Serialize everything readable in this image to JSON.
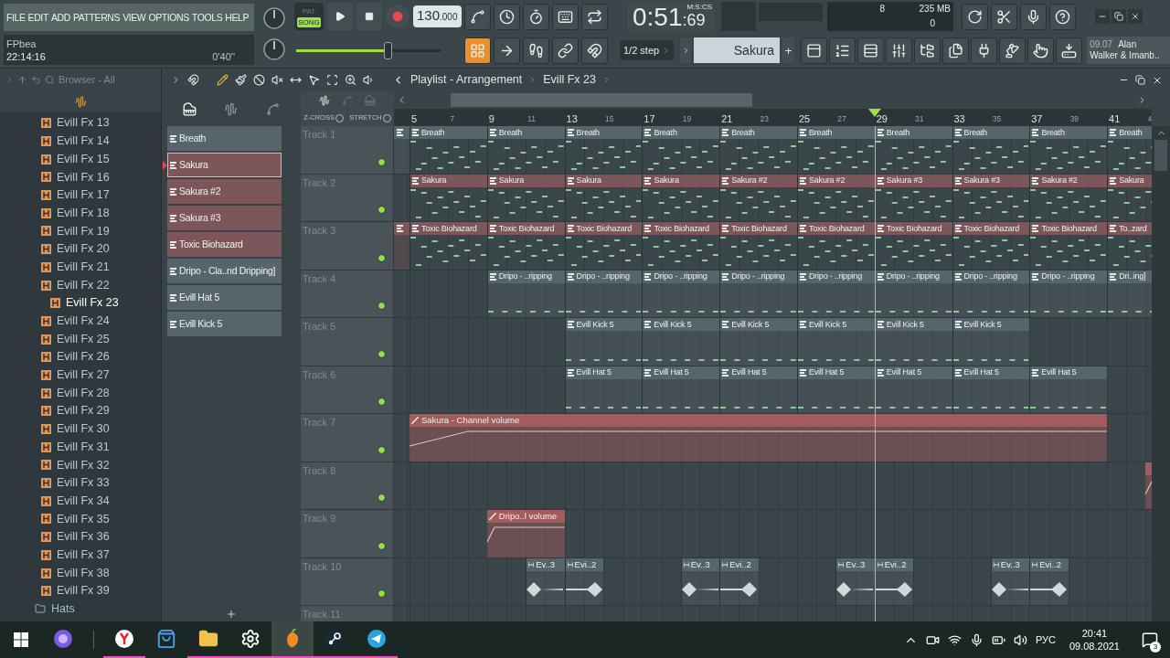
{
  "menu": [
    "FILE",
    "EDIT",
    "ADD",
    "PATTERNS",
    "VIEW",
    "OPTIONS",
    "TOOLS",
    "HELP"
  ],
  "hint": {
    "title": "FPbea",
    "time": "22:14:16",
    "length": "0'40''"
  },
  "transport": {
    "modes": [
      {
        "label": "PAT",
        "selected": false
      },
      {
        "label": "SONG",
        "selected": true
      }
    ],
    "tempo": "130",
    "tempo_decimals": ".000"
  },
  "master_volume": {
    "level": 0.63
  },
  "time": {
    "value": "0:51",
    "centiseconds": ":69",
    "format": "M:S:CS"
  },
  "cpu": {
    "voices": "8",
    "memory": "235 MB",
    "polyphony": "0"
  },
  "snap": "1/2 step",
  "pattern_selector": {
    "name": "Sakura",
    "add": "+"
  },
  "news": {
    "date": "09.07",
    "lines": [
      "Alan",
      "Walker & Imanb.."
    ]
  },
  "browser": {
    "title": "Browser - All",
    "items": [
      {
        "label": "Evill Fx 13",
        "kind": "file",
        "selected": false
      },
      {
        "label": "Evill Fx 14",
        "kind": "file",
        "selected": false
      },
      {
        "label": "Evill Fx 15",
        "kind": "file",
        "selected": false
      },
      {
        "label": "Evill Fx 16",
        "kind": "file",
        "selected": false
      },
      {
        "label": "Evill Fx 17",
        "kind": "file",
        "selected": false
      },
      {
        "label": "Evill Fx 18",
        "kind": "file",
        "selected": false
      },
      {
        "label": "Evill Fx 19",
        "kind": "file",
        "selected": false
      },
      {
        "label": "Evill Fx 20",
        "kind": "file",
        "selected": false
      },
      {
        "label": "Evill Fx 21",
        "kind": "file",
        "selected": false
      },
      {
        "label": "Evill Fx 22",
        "kind": "file",
        "selected": false
      },
      {
        "label": "Evill Fx 23",
        "kind": "file",
        "selected": true
      },
      {
        "label": "Evill Fx 24",
        "kind": "file",
        "selected": false
      },
      {
        "label": "Evill Fx 25",
        "kind": "file",
        "selected": false
      },
      {
        "label": "Evill Fx 26",
        "kind": "file",
        "selected": false
      },
      {
        "label": "Evill Fx 27",
        "kind": "file",
        "selected": false
      },
      {
        "label": "Evill Fx 28",
        "kind": "file",
        "selected": false
      },
      {
        "label": "Evill Fx 29",
        "kind": "file",
        "selected": false
      },
      {
        "label": "Evill Fx 30",
        "kind": "file",
        "selected": false
      },
      {
        "label": "Evill Fx 31",
        "kind": "file",
        "selected": false
      },
      {
        "label": "Evill Fx 32",
        "kind": "file",
        "selected": false
      },
      {
        "label": "Evill Fx 33",
        "kind": "file",
        "selected": false
      },
      {
        "label": "Evill Fx 34",
        "kind": "file",
        "selected": false
      },
      {
        "label": "Evill Fx 35",
        "kind": "file",
        "selected": false
      },
      {
        "label": "Evill Fx 36",
        "kind": "file",
        "selected": false
      },
      {
        "label": "Evill Fx 37",
        "kind": "file",
        "selected": false
      },
      {
        "label": "Evill Fx 38",
        "kind": "file",
        "selected": false
      },
      {
        "label": "Evill Fx 39",
        "kind": "file",
        "selected": false
      },
      {
        "label": "Hats",
        "kind": "folder",
        "selected": false
      }
    ]
  },
  "patterns": [
    {
      "name": "Breath",
      "color": "#56656b",
      "selected": false
    },
    {
      "name": "Sakura",
      "color": "#7c5659",
      "selected": true
    },
    {
      "name": "Sakura #2",
      "color": "#7c5659",
      "selected": false
    },
    {
      "name": "Sakura #3",
      "color": "#7c5659",
      "selected": false
    },
    {
      "name": "Toxic Biohazard",
      "color": "#7c5659",
      "selected": false
    },
    {
      "name": "Dripo - Cla..nd Dripping]",
      "color": "#56656b",
      "selected": false
    },
    {
      "name": "Evill Hat 5",
      "color": "#56656b",
      "selected": false
    },
    {
      "name": "Evill Kick 5",
      "color": "#56656b",
      "selected": false
    }
  ],
  "playlist": {
    "title": "Playlist - Arrangement",
    "current": "Evill Fx 23",
    "options": [
      "Z-CROSS",
      "STRETCH"
    ],
    "ruler": [
      {
        "label": "5",
        "major": true,
        "playhead": false
      },
      {
        "label": "7",
        "major": false,
        "playhead": false
      },
      {
        "label": "9",
        "major": true,
        "playhead": false
      },
      {
        "label": "11",
        "major": false,
        "playhead": false
      },
      {
        "label": "13",
        "major": true,
        "playhead": false
      },
      {
        "label": "15",
        "major": false,
        "playhead": false
      },
      {
        "label": "17",
        "major": true,
        "playhead": false
      },
      {
        "label": "19",
        "major": false,
        "playhead": false
      },
      {
        "label": "21",
        "major": true,
        "playhead": false
      },
      {
        "label": "23",
        "major": false,
        "playhead": false
      },
      {
        "label": "25",
        "major": true,
        "playhead": false
      },
      {
        "label": "27",
        "major": false,
        "playhead": false
      },
      {
        "label": "29",
        "major": true,
        "playhead": true
      },
      {
        "label": "31",
        "major": false,
        "playhead": false
      },
      {
        "label": "33",
        "major": true,
        "playhead": false
      },
      {
        "label": "35",
        "major": false,
        "playhead": false
      },
      {
        "label": "37",
        "major": true,
        "playhead": false
      },
      {
        "label": "39",
        "major": false,
        "playhead": false
      },
      {
        "label": "41",
        "major": true,
        "playhead": false
      },
      {
        "label": "4",
        "major": false,
        "playhead": false
      }
    ],
    "tracks": [
      {
        "name": "Track 1",
        "color": "#56656b",
        "enabled": true,
        "clips": [
          {
            "kind": "partial"
          },
          {
            "kind": "pattern",
            "label": "Breath"
          },
          {
            "kind": "pattern",
            "label": "Breath"
          },
          {
            "kind": "pattern",
            "label": "Breath"
          },
          {
            "kind": "pattern",
            "label": "Breath"
          },
          {
            "kind": "pattern",
            "label": "Breath"
          },
          {
            "kind": "pattern",
            "label": "Breath"
          },
          {
            "kind": "pattern",
            "label": "Breath"
          },
          {
            "kind": "pattern",
            "label": "Breath"
          },
          {
            "kind": "pattern",
            "label": "Breath"
          },
          {
            "kind": "pattern",
            "label": "Breath"
          }
        ]
      },
      {
        "name": "Track 2",
        "color": "#7c5659",
        "enabled": true,
        "clips": [
          {
            "kind": "pattern",
            "label": "Sakura"
          },
          {
            "kind": "pattern",
            "label": "Sakura"
          },
          {
            "kind": "pattern",
            "label": "Sakura"
          },
          {
            "kind": "pattern",
            "label": "Sakura"
          },
          {
            "kind": "pattern",
            "label": "Sakura #2"
          },
          {
            "kind": "pattern",
            "label": "Sakura #2"
          },
          {
            "kind": "pattern",
            "label": "Sakura #3"
          },
          {
            "kind": "pattern",
            "label": "Sakura #3"
          },
          {
            "kind": "pattern",
            "label": "Sakura #2"
          },
          {
            "kind": "pattern",
            "label": "Sakura"
          }
        ]
      },
      {
        "name": "Track 3",
        "color": "#7c5659",
        "enabled": true,
        "clips": [
          {
            "kind": "partial"
          },
          {
            "kind": "pattern",
            "label": "Toxic Biohazard"
          },
          {
            "kind": "pattern",
            "label": "Toxic Biohazard"
          },
          {
            "kind": "pattern",
            "label": "Toxic Biohazard"
          },
          {
            "kind": "pattern",
            "label": "Toxic Biohazard"
          },
          {
            "kind": "pattern",
            "label": "Toxic Biohazard"
          },
          {
            "kind": "pattern",
            "label": "Toxic Biohazard"
          },
          {
            "kind": "pattern",
            "label": "Toxic Biohazard"
          },
          {
            "kind": "pattern",
            "label": "Toxic Biohazard"
          },
          {
            "kind": "pattern",
            "label": "Toxic Biohazard"
          },
          {
            "kind": "pattern",
            "label": "To..zard"
          }
        ]
      },
      {
        "name": "Track 4",
        "color": "#56656b",
        "enabled": true,
        "clips": [
          {
            "kind": "gap"
          },
          {
            "kind": "gap"
          },
          {
            "kind": "pattern",
            "label": "Dripo - ..ripping"
          },
          {
            "kind": "pattern",
            "label": "Dripo - ..ripping"
          },
          {
            "kind": "pattern",
            "label": "Dripo - ..ripping"
          },
          {
            "kind": "pattern",
            "label": "Dripo - ..ripping"
          },
          {
            "kind": "pattern",
            "label": "Dripo - ..ripping"
          },
          {
            "kind": "pattern",
            "label": "Dripo - ..ripping"
          },
          {
            "kind": "pattern",
            "label": "Dripo - ..ripping"
          },
          {
            "kind": "pattern",
            "label": "Dripo - ..ripping"
          },
          {
            "kind": "pattern",
            "label": "Dri..ing]"
          }
        ]
      },
      {
        "name": "Track 5",
        "color": "#56656b",
        "enabled": true,
        "clips": [
          {
            "kind": "gap"
          },
          {
            "kind": "gap"
          },
          {
            "kind": "gap"
          },
          {
            "kind": "gap"
          },
          {
            "kind": "pattern",
            "label": "Evill Kick 5"
          },
          {
            "kind": "pattern",
            "label": "Evill Kick 5"
          },
          {
            "kind": "pattern",
            "label": "Evill Kick 5"
          },
          {
            "kind": "pattern",
            "label": "Evill Kick 5"
          },
          {
            "kind": "pattern",
            "label": "Evill Kick 5"
          },
          {
            "kind": "pattern",
            "label": "Evill Kick 5"
          }
        ]
      },
      {
        "name": "Track 6",
        "color": "#56656b",
        "enabled": true,
        "clips": [
          {
            "kind": "gap"
          },
          {
            "kind": "gap"
          },
          {
            "kind": "gap"
          },
          {
            "kind": "gap"
          },
          {
            "kind": "pattern",
            "label": "Evill Hat 5"
          },
          {
            "kind": "pattern",
            "label": "Evill Hat 5"
          },
          {
            "kind": "pattern",
            "label": "Evill Hat 5"
          },
          {
            "kind": "pattern",
            "label": "Evill Hat 5"
          },
          {
            "kind": "pattern",
            "label": "Evill Hat 5"
          },
          {
            "kind": "pattern",
            "label": "Evill Hat 5"
          },
          {
            "kind": "pattern",
            "label": "Evill Hat 5"
          }
        ]
      },
      {
        "name": "Track 7",
        "color": "#a35b5e",
        "enabled": true,
        "clips": [
          {
            "kind": "automation",
            "label": "Sakura - Channel volume",
            "wide": true
          }
        ]
      },
      {
        "name": "Track 8",
        "color": "#a35b5e",
        "enabled": true,
        "clips": [
          {
            "kind": "gap"
          },
          {
            "kind": "gap"
          },
          {
            "kind": "gap"
          },
          {
            "kind": "gap"
          },
          {
            "kind": "gap"
          },
          {
            "kind": "gap"
          },
          {
            "kind": "gap"
          },
          {
            "kind": "gap"
          },
          {
            "kind": "gap"
          },
          {
            "kind": "gap"
          },
          {
            "kind": "gap"
          },
          {
            "kind": "gap"
          },
          {
            "kind": "gap"
          },
          {
            "kind": "gap"
          },
          {
            "kind": "gap"
          },
          {
            "kind": "gap"
          },
          {
            "kind": "gap"
          },
          {
            "kind": "gap"
          },
          {
            "kind": "gap"
          },
          {
            "kind": "automation",
            "wide": false
          }
        ]
      },
      {
        "name": "Track 9",
        "color": "#a35b5e",
        "enabled": true,
        "clips": [
          {
            "kind": "gap"
          },
          {
            "kind": "gap"
          },
          {
            "kind": "automation",
            "label": "Dripo..l volume",
            "wide": false
          }
        ]
      },
      {
        "name": "Track 10",
        "color": "#56656b",
        "enabled": true,
        "clips": [
          {
            "kind": "gap"
          },
          {
            "kind": "gap"
          },
          {
            "kind": "gap"
          },
          {
            "kind": "audio",
            "label": "Ev..3"
          },
          {
            "kind": "audio",
            "label": "Evi..2"
          },
          {
            "kind": "gap"
          },
          {
            "kind": "gap"
          },
          {
            "kind": "audio",
            "label": "Ev..3"
          },
          {
            "kind": "audio",
            "label": "Evi..2"
          },
          {
            "kind": "gap"
          },
          {
            "kind": "gap"
          },
          {
            "kind": "audio",
            "label": "Ev..3"
          },
          {
            "kind": "audio",
            "label": "Evi..2"
          },
          {
            "kind": "gap"
          },
          {
            "kind": "gap"
          },
          {
            "kind": "audio",
            "label": "Ev..3"
          },
          {
            "kind": "audio",
            "label": "Evi..2"
          }
        ]
      },
      {
        "name": "Track 11"
      }
    ]
  },
  "taskbar": {
    "apps": [
      {
        "running": false,
        "active": false
      },
      {
        "running": true,
        "active": false
      },
      {
        "running": false,
        "active": false
      },
      {
        "running": true,
        "active": false
      },
      {
        "running": true,
        "active": false
      },
      {
        "running": true,
        "active": true
      },
      {
        "running": true,
        "active": false
      },
      {
        "running": true,
        "active": false
      }
    ],
    "language": "РУС",
    "time": "20:41",
    "date": "09.08.2021",
    "notifications": "3"
  }
}
